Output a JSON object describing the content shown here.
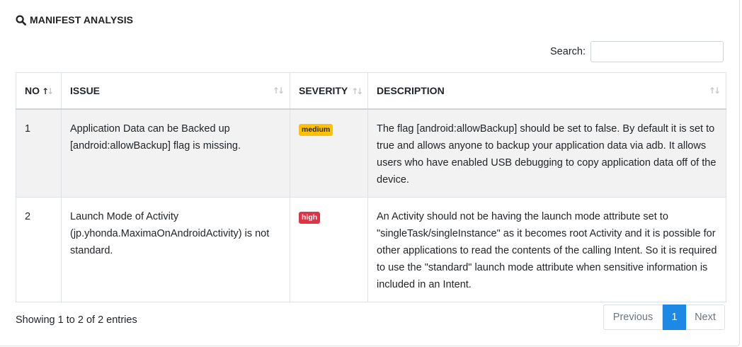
{
  "section": {
    "title": "MANIFEST ANALYSIS",
    "icon": "search-icon"
  },
  "search": {
    "label": "Search:",
    "value": "",
    "placeholder": ""
  },
  "table": {
    "columns": [
      "NO",
      "ISSUE",
      "SEVERITY",
      "DESCRIPTION"
    ],
    "rows": [
      {
        "no": "1",
        "issue": "Application Data can be Backed up [android:allowBackup] flag is missing.",
        "severity": "medium",
        "description": "The flag [android:allowBackup] should be set to false. By default it is set to true and allows anyone to backup your application data via adb. It allows users who have enabled USB debugging to copy application data off of the device."
      },
      {
        "no": "2",
        "issue": "Launch Mode of Activity (jp.yhonda.MaximaOnAndroidActivity) is not standard.",
        "severity": "high",
        "description": "An Activity should not be having the launch mode attribute set to \"singleTask/singleInstance\" as it becomes root Activity and it is possible for other applications to read the contents of the calling Intent. So it is required to use the \"standard\" launch mode attribute when sensitive information is included in an Intent."
      }
    ]
  },
  "footer": {
    "info": "Showing 1 to 2 of 2 entries",
    "previous": "Previous",
    "current_page": "1",
    "next": "Next"
  },
  "colors": {
    "medium": "#ffc107",
    "high": "#dc3545",
    "active_page": "#1e88e5"
  }
}
